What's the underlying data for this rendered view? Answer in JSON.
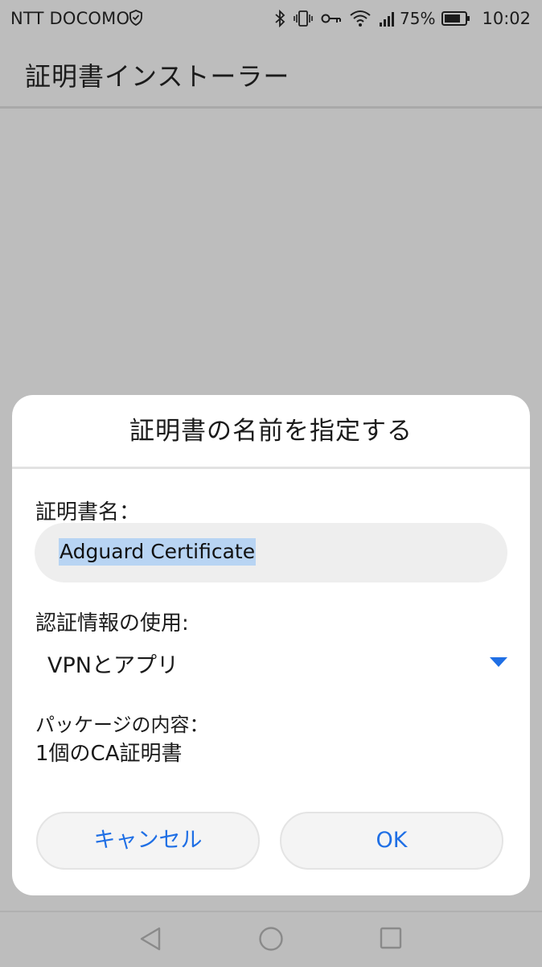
{
  "status_bar": {
    "carrier": "NTT DOCOMO",
    "battery_percent": "75%",
    "time": "10:02",
    "icons": [
      "shield-icon",
      "bluetooth-icon",
      "vibrate-icon",
      "vpn-key-icon",
      "wifi-icon",
      "signal-icon",
      "battery-icon"
    ]
  },
  "app_bar": {
    "title": "証明書インストーラー"
  },
  "dialog": {
    "title": "証明書の名前を指定する",
    "name_label": "証明書名：",
    "name_value": "Adguard Certificate",
    "usage_label": "認証情報の使用:",
    "usage_value": "VPNとアプリ",
    "content_label": "パッケージの内容：",
    "content_value": "1個のCA証明書",
    "cancel_label": "キャンセル",
    "ok_label": "OK"
  },
  "nav_bar": {
    "icons": [
      "back-icon",
      "home-icon",
      "recents-icon"
    ]
  },
  "colors": {
    "accent": "#1f6fe5",
    "scrim": "#bdbdbd",
    "selection": "#b8d4f3"
  }
}
